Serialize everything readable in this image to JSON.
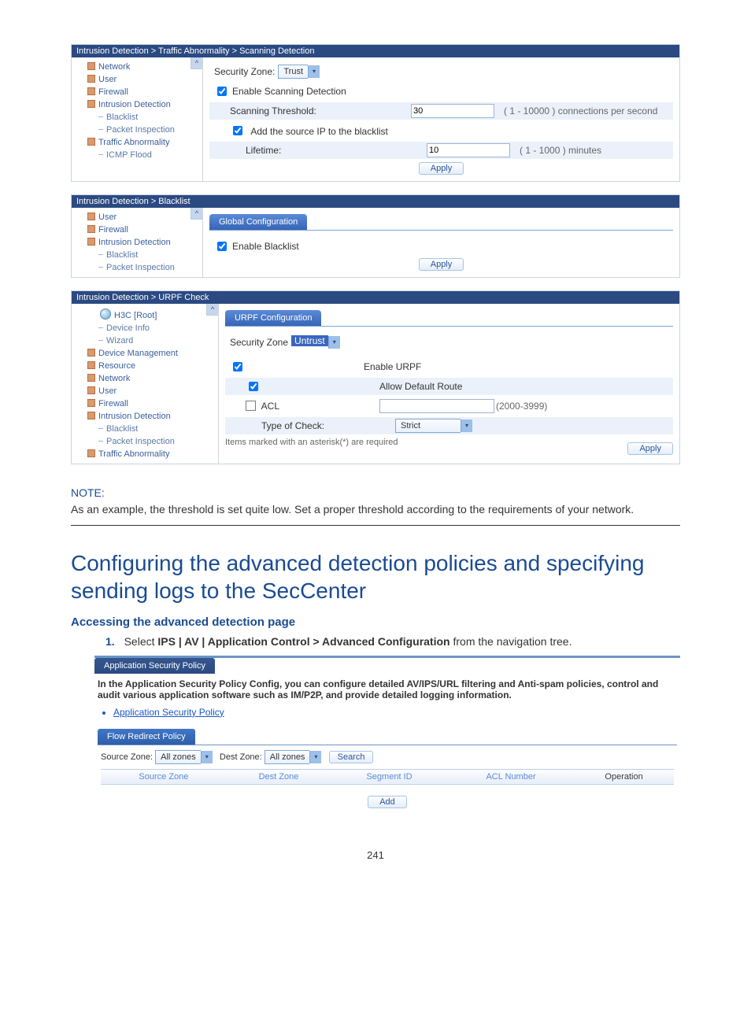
{
  "panel1": {
    "breadcrumb": "Intrusion Detection > Traffic Abnormality > Scanning Detection",
    "nav": [
      "Network",
      "User",
      "Firewall",
      "Intrusion Detection",
      "Blacklist",
      "Packet Inspection",
      "Traffic Abnormality",
      "ICMP Flood"
    ],
    "sec_zone_label": "Security Zone:",
    "sec_zone_value": "Trust",
    "enable_scan": "Enable Scanning Detection",
    "scan_threshold": "Scanning Threshold:",
    "scan_threshold_val": "30",
    "scan_threshold_hint": "( 1 - 10000 ) connections per second",
    "add_source": "Add the source IP to the blacklist",
    "lifetime": "Lifetime:",
    "lifetime_val": "10",
    "lifetime_hint": "( 1 - 1000 ) minutes",
    "apply": "Apply"
  },
  "panel2": {
    "breadcrumb": "Intrusion Detection > Blacklist",
    "nav": [
      "User",
      "Firewall",
      "Intrusion Detection",
      "Blacklist",
      "Packet Inspection"
    ],
    "tab": "Global Configuration",
    "enable_blacklist": "Enable Blacklist",
    "apply": "Apply"
  },
  "panel3": {
    "breadcrumb": "Intrusion Detection > URPF Check",
    "nav": [
      "H3C [Root]",
      "Device Info",
      "Wizard",
      "Device Management",
      "Resource",
      "Network",
      "User",
      "Firewall",
      "Intrusion Detection",
      "Blacklist",
      "Packet Inspection",
      "Traffic Abnormality"
    ],
    "tab": "URPF Configuration",
    "sec_zone_label": "Security Zone",
    "sec_zone_value": "Untrust",
    "enable_urpf": "Enable URPF",
    "allow_default": "Allow Default Route",
    "acl": "ACL",
    "acl_hint": "(2000-3999)",
    "type_check": "Type of Check:",
    "type_check_val": "Strict",
    "req": "Items marked with an asterisk(*) are required",
    "apply": "Apply"
  },
  "note_head": "NOTE:",
  "note_body": "As an example, the threshold is set quite low. Set a proper threshold according to the requirements of your network.",
  "section_title": "Configuring the advanced detection policies and specifying sending logs to the SecCenter",
  "subhead": "Accessing the advanced detection page",
  "step1_num": "1.",
  "step1_a": "Select ",
  "step1_b": "IPS | AV | Application Control > Advanced Configuration",
  "step1_c": " from the navigation tree.",
  "app": {
    "tab": "Application Security Policy",
    "desc": "In the Application Security Policy Config, you can configure detailed AV/IPS/URL filtering and Anti-spam policies, control and audit various application software such as IM/P2P, and provide detailed logging information.",
    "link": "Application Security Policy",
    "flow_tab": "Flow Redirect Policy",
    "src_zone_label": "Source Zone:",
    "src_zone_val": "All zones",
    "dest_zone_label": "Dest Zone:",
    "dest_zone_val": "All zones",
    "search": "Search",
    "cols": [
      "Source Zone",
      "Dest Zone",
      "Segment ID",
      "ACL Number",
      "Operation"
    ],
    "add": "Add"
  },
  "page_num": "241"
}
